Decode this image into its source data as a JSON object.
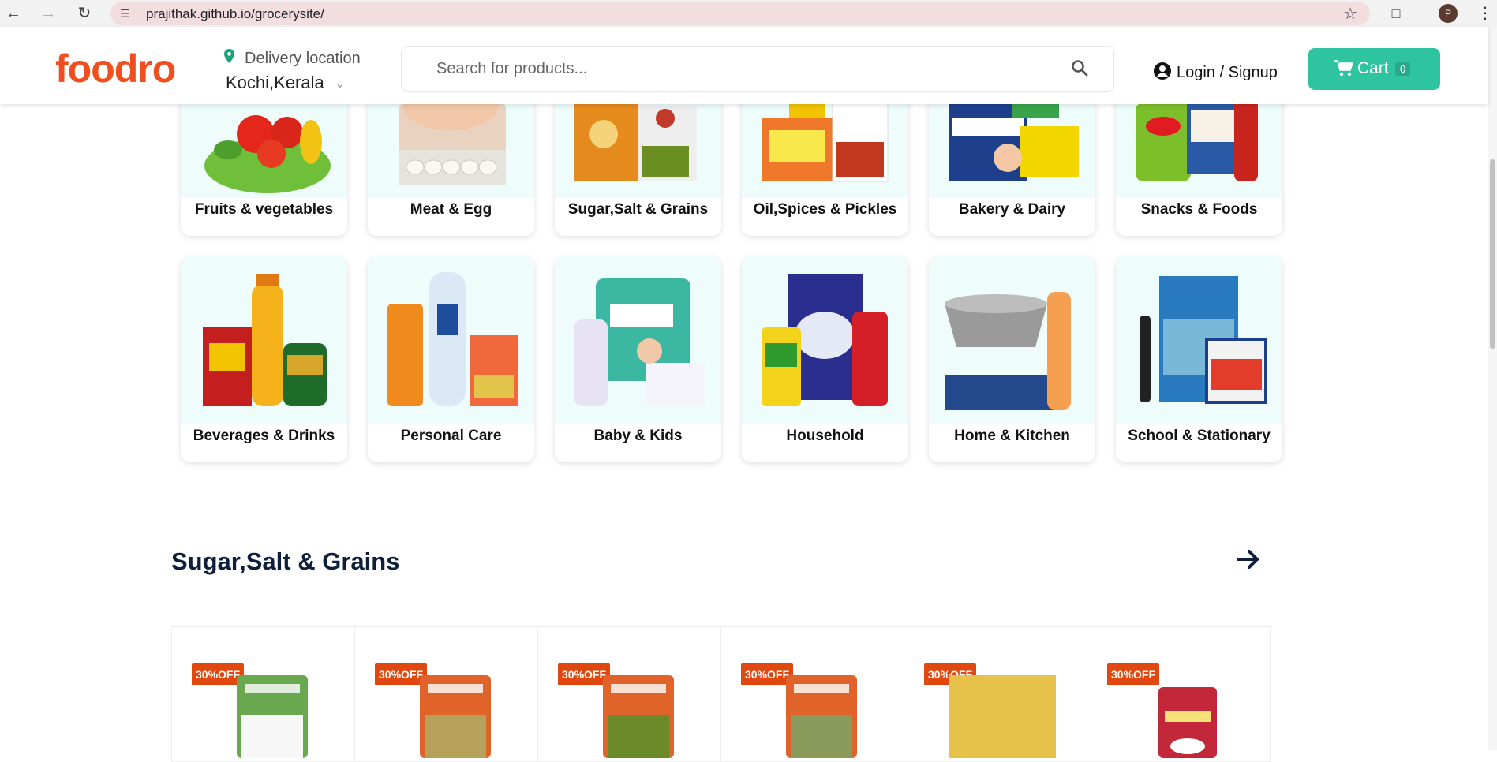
{
  "browser": {
    "url": "prajithak.github.io/grocerysite/",
    "profile_initial": "P"
  },
  "header": {
    "logo": "foodro",
    "delivery_label": "Delivery location",
    "delivery_city": "Kochi,Kerala",
    "search_placeholder": "Search for products...",
    "login_label": "Login / Signup",
    "cart_label": "Cart",
    "cart_count": "0"
  },
  "categories": [
    {
      "label": "Fruits & vegetables"
    },
    {
      "label": "Meat & Egg"
    },
    {
      "label": "Sugar,Salt & Grains"
    },
    {
      "label": "Oil,Spices & Pickles"
    },
    {
      "label": "Bakery & Dairy"
    },
    {
      "label": "Snacks & Foods"
    },
    {
      "label": "Beverages & Drinks"
    },
    {
      "label": "Personal Care"
    },
    {
      "label": "Baby & Kids"
    },
    {
      "label": "Household"
    },
    {
      "label": "Home & Kitchen"
    },
    {
      "label": "School & Stationary"
    }
  ],
  "section": {
    "title": "Sugar,Salt & Grains"
  },
  "products": [
    {
      "discount": "30%OFF",
      "color": "#6aa84f"
    },
    {
      "discount": "30%OFF",
      "color": "#e0642a"
    },
    {
      "discount": "30%OFF",
      "color": "#e0642a"
    },
    {
      "discount": "30%OFF",
      "color": "#e0642a"
    },
    {
      "discount": "30%OFF",
      "color": "#e6c24a"
    },
    {
      "discount": "30%OFF",
      "color": "#c2283a"
    }
  ],
  "colors": {
    "brand": "#f04e1e",
    "cart": "#2ec4a0",
    "discount": "#e0480f",
    "heading": "#0e1f3b"
  }
}
